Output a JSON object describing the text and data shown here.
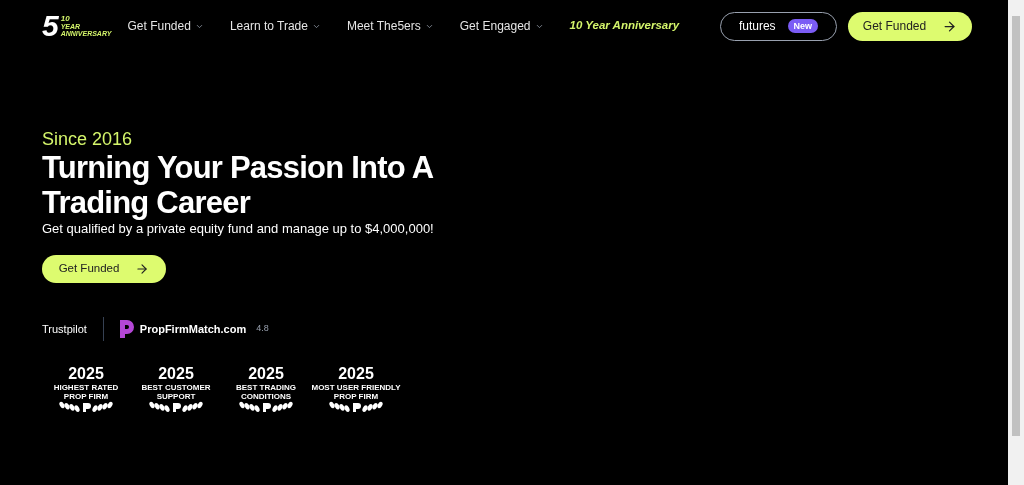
{
  "logo": {
    "digit": "5",
    "number": "10",
    "lines": [
      "YEAR",
      "ANNIVERSARY"
    ]
  },
  "nav": [
    {
      "label": "Get Funded",
      "kind": "dropdown"
    },
    {
      "label": "Learn to Trade",
      "kind": "dropdown"
    },
    {
      "label": "Meet The5ers",
      "kind": "dropdown"
    },
    {
      "label": "Get Engaged",
      "kind": "dropdown"
    },
    {
      "label": "10 Year Anniversary",
      "kind": "highlight"
    }
  ],
  "futures_button": {
    "label": "futures",
    "badge": "New"
  },
  "cta_button": {
    "label": "Get Funded"
  },
  "hero": {
    "eyebrow": "Since 2016",
    "title": "Turning Your Passion Into A Trading Career",
    "subtitle": "Get qualified by a private equity fund and manage up to $4,000,000!",
    "button": "Get Funded"
  },
  "ratings": [
    {
      "kind": "trustpilot",
      "label": "Trustpilot"
    },
    {
      "kind": "propfirmmatch",
      "label": "PropFirmMatch.com",
      "score": "4.8"
    }
  ],
  "awards": [
    {
      "year": "2025",
      "lines": [
        "HIGHEST RATED",
        "PROP FIRM"
      ]
    },
    {
      "year": "2025",
      "lines": [
        "BEST CUSTOMER",
        "SUPPORT"
      ]
    },
    {
      "year": "2025",
      "lines": [
        "BEST TRADING",
        "CONDITIONS"
      ]
    },
    {
      "year": "2025",
      "lines": [
        "MOST USER FRIENDLY",
        "PROP FIRM"
      ]
    }
  ]
}
